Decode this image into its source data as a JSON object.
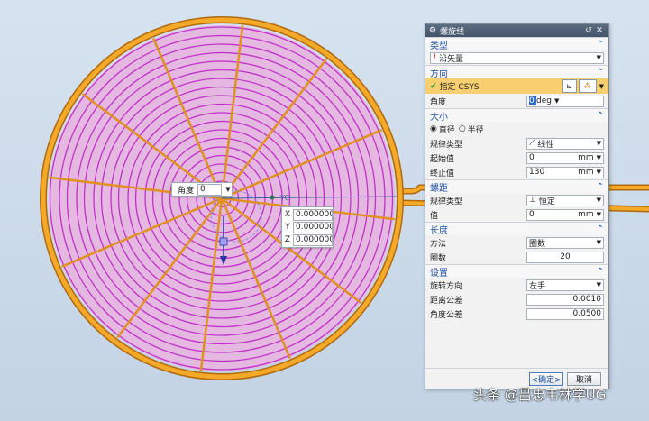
{
  "viewport": {
    "angle_label": "角度",
    "angle_value": "0",
    "axis_label": "YC",
    "coords": [
      {
        "axis": "X",
        "value": "0.000000"
      },
      {
        "axis": "Y",
        "value": "0.000000"
      },
      {
        "axis": "Z",
        "value": "0.000000"
      }
    ]
  },
  "dialog": {
    "title": "螺旋线",
    "type_section": {
      "title": "类型",
      "selected": "沿矢量"
    },
    "direction_section": {
      "title": "方向",
      "specify_csys": "指定 CSYS",
      "angle_label": "角度",
      "angle_value": "0",
      "angle_unit": "deg"
    },
    "size_section": {
      "title": "大小",
      "radio_diameter": "直径",
      "radio_radius": "半径",
      "law_type_label": "规律类型",
      "law_type_value": "线性",
      "start_label": "起始值",
      "start_value": "0",
      "start_unit": "mm",
      "end_label": "终止值",
      "end_value": "130",
      "end_unit": "mm"
    },
    "pitch_section": {
      "title": "螺距",
      "law_type_label": "规律类型",
      "law_type_value": "恒定",
      "value_label": "值",
      "value": "0",
      "value_unit": "mm"
    },
    "length_section": {
      "title": "长度",
      "method_label": "方法",
      "method_value": "圈数",
      "turns_label": "圈数",
      "turns_value": "20"
    },
    "settings_section": {
      "title": "设置",
      "rotation_label": "旋转方向",
      "rotation_value": "左手",
      "dist_tol_label": "距离公差",
      "dist_tol_value": "0.0010",
      "angle_tol_label": "角度公差",
      "angle_tol_value": "0.0500"
    },
    "ok_label": "<确定>",
    "cancel_label": "取消"
  },
  "watermark": "头条 @吕忠韦林学UG",
  "colors": {
    "wire": "#f0a020",
    "fill": "#e4b8e0",
    "spiral": "#c030c8",
    "accent": "#1d4fa0"
  }
}
